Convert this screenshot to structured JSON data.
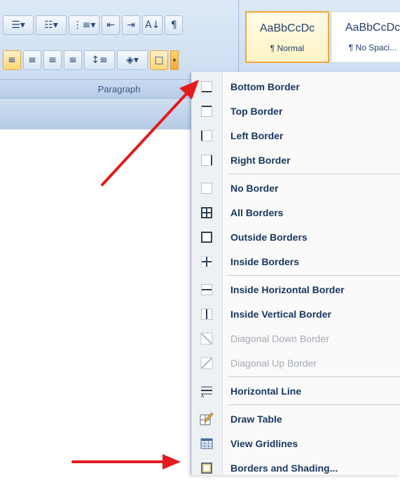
{
  "ribbon": {
    "paragraph_group_label": "Paragraph",
    "row1": [
      "☰▾",
      "☷▾",
      "⋮≡▾",
      "⇤",
      "⇥",
      "A↓",
      "¶"
    ],
    "row2": [
      "≡",
      "≡",
      "≡",
      "≡",
      "↕≡",
      "◈▾",
      "□"
    ],
    "styles": [
      {
        "sample": "AaBbCcDc",
        "name": "¶ Normal"
      },
      {
        "sample": "AaBbCcDc",
        "name": "¶ No Spaci..."
      }
    ]
  },
  "menu": {
    "items": [
      {
        "label": "Bottom Border",
        "icon": "bottom-border-icon",
        "disabled": false
      },
      {
        "label": "Top Border",
        "icon": "top-border-icon",
        "disabled": false
      },
      {
        "label": "Left Border",
        "icon": "left-border-icon",
        "disabled": false
      },
      {
        "label": "Right Border",
        "icon": "right-border-icon",
        "disabled": false
      },
      {
        "label": "No Border",
        "icon": "no-border-icon",
        "disabled": false
      },
      {
        "label": "All Borders",
        "icon": "all-borders-icon",
        "disabled": false
      },
      {
        "label": "Outside Borders",
        "icon": "outside-borders-icon",
        "disabled": false
      },
      {
        "label": "Inside Borders",
        "icon": "inside-borders-icon",
        "disabled": false
      },
      {
        "label": "Inside Horizontal Border",
        "icon": "inside-horizontal-border-icon",
        "disabled": false
      },
      {
        "label": "Inside Vertical Border",
        "icon": "inside-vertical-border-icon",
        "disabled": false
      },
      {
        "label": "Diagonal Down Border",
        "icon": "diagonal-down-border-icon",
        "disabled": true
      },
      {
        "label": "Diagonal Up Border",
        "icon": "diagonal-up-border-icon",
        "disabled": true
      },
      {
        "label": "Horizontal Line",
        "icon": "horizontal-line-icon",
        "disabled": false
      },
      {
        "label": "Draw Table",
        "icon": "draw-table-icon",
        "disabled": false
      },
      {
        "label": "View Gridlines",
        "icon": "view-gridlines-icon",
        "disabled": false
      },
      {
        "label": "Borders and Shading...",
        "icon": "borders-and-shading-icon",
        "disabled": false
      }
    ]
  },
  "colors": {
    "menu_text": "#17365d",
    "disabled_text": "#a3a9b1",
    "highlight": "#ffd77a",
    "arrow": "#e31b1b"
  }
}
